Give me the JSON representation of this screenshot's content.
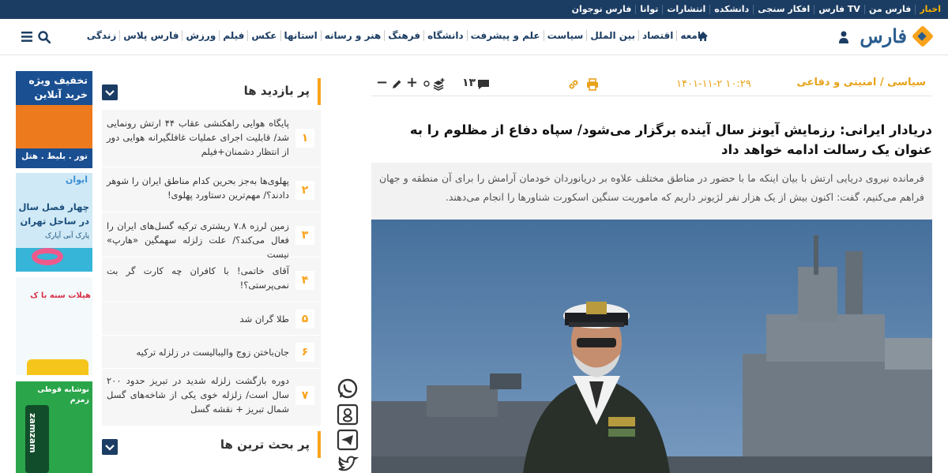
{
  "topbar": {
    "links": [
      "اخبار",
      "فارس من",
      "فارس TV",
      "افکار سنجی",
      "دانشکده",
      "انتشارات",
      "توانا",
      "فارس نوجوان"
    ],
    "active_color": "#ffb400"
  },
  "header": {
    "logo_text": "فارس",
    "nav": [
      "جامعه",
      "اقتصاد",
      "بین الملل",
      "سیاست",
      "علم و پیشرفت",
      "دانشگاه",
      "فرهنگ",
      "هنر و رسانه",
      "استانها",
      "عکس",
      "فیلم",
      "ورزش",
      "فارس پلاس",
      "زندگی"
    ],
    "icons": [
      "home-icon",
      "user-icon",
      "search-icon",
      "menu-icon"
    ]
  },
  "article": {
    "category": "سیاسی / امنیتی و دفاعی",
    "date": "۱۴۰۱-۱۱-۲ ۱۰:۲۹",
    "comment_count": "۱۳",
    "font_size_tools": [
      "+",
      "−"
    ],
    "headline": "دریادار ایرانی: رزمایش آیونز سال آینده برگزار می‌شود/ سپاه دفاع از مظلوم را به عنوان یک رسالت ادامه خواهد داد",
    "lead": "فرمانده نیروی دریایی ارتش با بیان اینکه ما با حضور در مناطق مختلف علاوه بر دریانوردان خودمان آرامش را برای آن منطقه و جهان فراهم می‌کنیم، گفت: اکنون بیش از یک هزار نفر لژیونر داریم که ماموریت سنگین اسکورت شناورها را انجام می‌دهند.",
    "accent_color": "#e8a21a"
  },
  "sidebar": {
    "most_viewed_title": "پر بازدید ها",
    "most_discussed_title": "پر بحث ترین ها",
    "items": [
      {
        "num": "۱",
        "text": "پایگاه هوایی راهکنشی عقاب ۴۴ ارتش رونمایی شد/ قابلیت اجرای عملیات غافلگیرانه هوایی دور از انتظار دشمنان+فیلم"
      },
      {
        "num": "۲",
        "text": "پهلوی‌ها به‌جز بحرین کدام مناطق ایران را شوهر دادند؟/ مهم‌ترین دستاورد پهلوی!"
      },
      {
        "num": "۳",
        "text": "زمین لرزه ۷.۸ ریشتری ترکیه گسل‌های ایران را فعال می‌کند؟/ علت زلزله سهمگین «هارپ» نیست"
      },
      {
        "num": "۴",
        "text": "آقای خاتمی! با کافران چه کارت گر بت نمی‌پرستی؟!"
      },
      {
        "num": "۵",
        "text": "طلا گران شد"
      },
      {
        "num": "۶",
        "text": "جان‌باختن زوج والیبالیست در زلزله ترکیه"
      },
      {
        "num": "۷",
        "text": "دوره بازگشت زلزله شدید در تبریز حدود ۲۰۰ سال است/ زلزله خوی یکی از شاخه‌های گسل شمال تبریز + نقشه گسل"
      }
    ]
  },
  "share": [
    "whatsapp-icon",
    "google-icon",
    "telegram-icon",
    "twitter-icon"
  ],
  "ads": {
    "ad1_title": "تخفیف ویژه خرید آنلاین",
    "ad1_sub": "تور . بلیط . هتل",
    "ad2_logo": "ایوان",
    "ad2_title": "چهار فصل سال در ساحل تهران",
    "ad2_sub": "پارک آبی آپارک",
    "ad3_title": "هیلات سنه با ک",
    "ad4_title": "نوشابه قوطی زمزم",
    "ad4_brand": "zamzam"
  }
}
